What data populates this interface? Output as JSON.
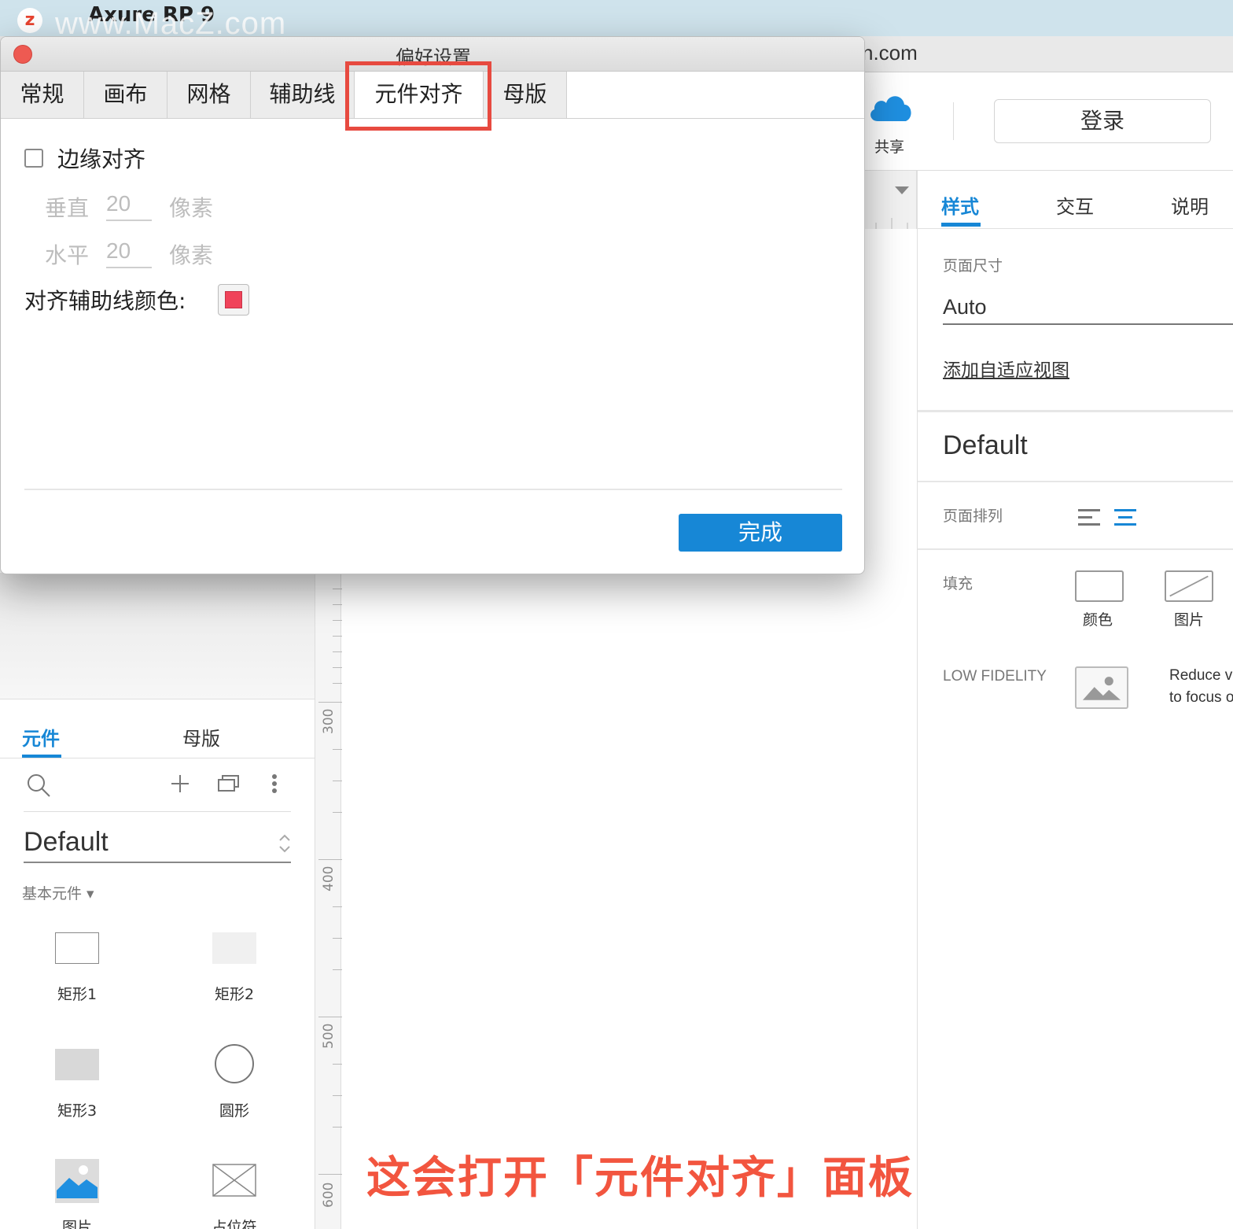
{
  "menubar": {
    "app_name": "Axure RP 9",
    "watermark": "www.MacZ.com",
    "logo_letter": "z"
  },
  "main_window": {
    "title_tail": "n.com"
  },
  "toolbar": {
    "share_label": "共享",
    "login_label": "登录"
  },
  "inspector": {
    "tabs": [
      {
        "label": "样式",
        "active": true
      },
      {
        "label": "交互",
        "active": false
      },
      {
        "label": "说明",
        "active": false
      }
    ],
    "page_size_label": "页面尺寸",
    "page_size_value": "Auto",
    "add_adaptive_link": "添加自适应视图",
    "style_name": "Default",
    "page_align_label": "页面排列",
    "fill_label": "填充",
    "fill_color_label": "颜色",
    "fill_image_label": "图片",
    "low_fidelity_label": "LOW FIDELITY",
    "low_fidelity_desc_line1": "Reduce v",
    "low_fidelity_desc_line2": "to focus o"
  },
  "ruler": {
    "labels": [
      "300",
      "400",
      "500",
      "600"
    ]
  },
  "left_panel": {
    "tabs": [
      {
        "label": "元件",
        "active": true
      },
      {
        "label": "母版",
        "active": false
      }
    ],
    "library_name": "Default",
    "category": "基本元件 ▾",
    "widgets": [
      {
        "label": "矩形1"
      },
      {
        "label": "矩形2"
      },
      {
        "label": "矩形3"
      },
      {
        "label": "圆形"
      },
      {
        "label": "图片"
      },
      {
        "label": "占位符"
      }
    ]
  },
  "dialog": {
    "title": "偏好设置",
    "tabs": [
      {
        "label": "常规",
        "active": false
      },
      {
        "label": "画布",
        "active": false
      },
      {
        "label": "网格",
        "active": false
      },
      {
        "label": "辅助线",
        "active": false
      },
      {
        "label": "元件对齐",
        "active": true
      },
      {
        "label": "母版",
        "active": false
      }
    ],
    "edge_snap_label": "边缘对齐",
    "edge_snap_checked": false,
    "vertical_label": "垂直",
    "vertical_value": "20",
    "horizontal_label": "水平",
    "horizontal_value": "20",
    "unit_label": "像素",
    "guide_color_label": "对齐辅助线颜色:",
    "guide_color": "#f0435a",
    "done_label": "完成"
  },
  "caption": "这会打开「元件对齐」面板",
  "colors": {
    "accent": "#1787d6",
    "highlight": "#e74a40",
    "caption": "#f2553f"
  }
}
